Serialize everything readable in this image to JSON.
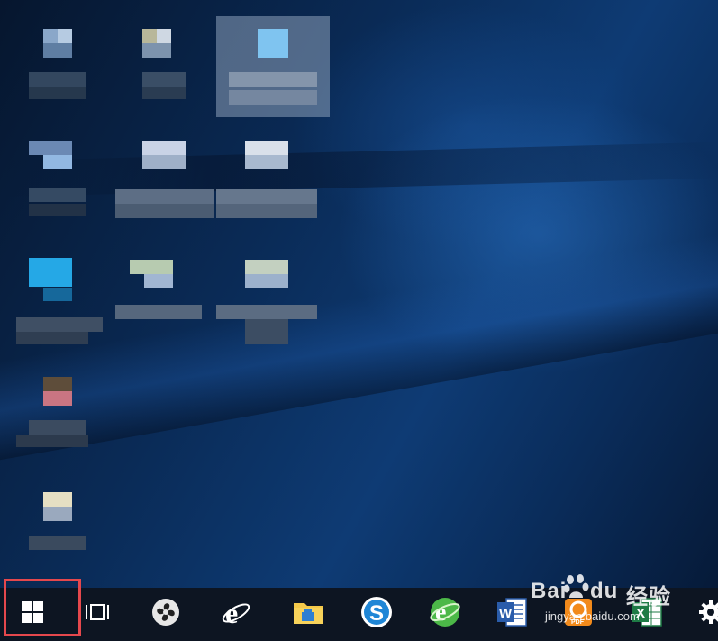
{
  "desktop": {
    "icons": [
      {
        "name": "desktop-icon-1"
      },
      {
        "name": "desktop-icon-2"
      },
      {
        "name": "desktop-icon-3"
      },
      {
        "name": "desktop-icon-4"
      },
      {
        "name": "desktop-icon-5"
      },
      {
        "name": "desktop-icon-6"
      },
      {
        "name": "desktop-icon-7"
      },
      {
        "name": "desktop-icon-8"
      },
      {
        "name": "desktop-icon-9"
      },
      {
        "name": "desktop-icon-10"
      },
      {
        "name": "desktop-icon-11"
      }
    ]
  },
  "taskbar": {
    "items": [
      {
        "id": "start",
        "icon": "windows-logo-icon"
      },
      {
        "id": "task-view",
        "icon": "task-view-icon"
      },
      {
        "id": "pinwheel-app",
        "icon": "pinwheel-icon"
      },
      {
        "id": "internet-explorer",
        "icon": "internet-explorer-icon"
      },
      {
        "id": "file-explorer",
        "icon": "folder-icon"
      },
      {
        "id": "sogou-browser",
        "icon": "sogou-s-icon"
      },
      {
        "id": "360-browser",
        "icon": "360-browser-icon"
      },
      {
        "id": "word",
        "icon": "word-icon"
      },
      {
        "id": "pdf-app",
        "icon": "pdf-icon"
      },
      {
        "id": "excel",
        "icon": "excel-icon"
      },
      {
        "id": "settings",
        "icon": "gear-icon"
      }
    ]
  },
  "watermark": {
    "brand": "Bai",
    "brand2": "du",
    "cn": "经验",
    "url": "jingyan.baidu.com"
  },
  "colors": {
    "taskbar": "#0d1522",
    "highlight": "#e5484d"
  }
}
